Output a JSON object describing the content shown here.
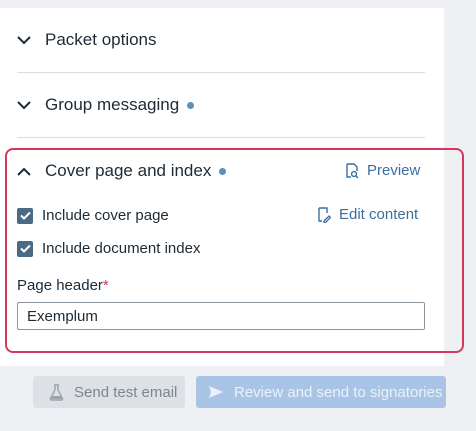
{
  "sections": {
    "packet_options": {
      "title": "Packet options"
    },
    "group_messaging": {
      "title": "Group messaging"
    },
    "cover_page": {
      "title": "Cover page and index"
    }
  },
  "cover_page": {
    "preview_label": "Preview",
    "edit_content_label": "Edit content",
    "include_cover_page": {
      "label": "Include cover page",
      "checked": true
    },
    "include_document_index": {
      "label": "Include document index",
      "checked": true
    },
    "page_header": {
      "label": "Page header",
      "required_marker": "*",
      "value": "Exemplum"
    }
  },
  "footer": {
    "send_test_email_label": "Send test email",
    "review_send_label": "Review and send to signatories"
  },
  "colors": {
    "accent": "#3b6fa0",
    "status_dot": "#5f8fb4",
    "focus_border": "#d6375d",
    "checkbox": "#4a6b85"
  },
  "icons": {
    "chevron_collapsed": "chevron-down-icon",
    "chevron_expanded": "chevron-up-icon",
    "preview": "document-search-icon",
    "edit": "edit-document-icon",
    "flask": "flask-icon",
    "send": "send-icon"
  }
}
